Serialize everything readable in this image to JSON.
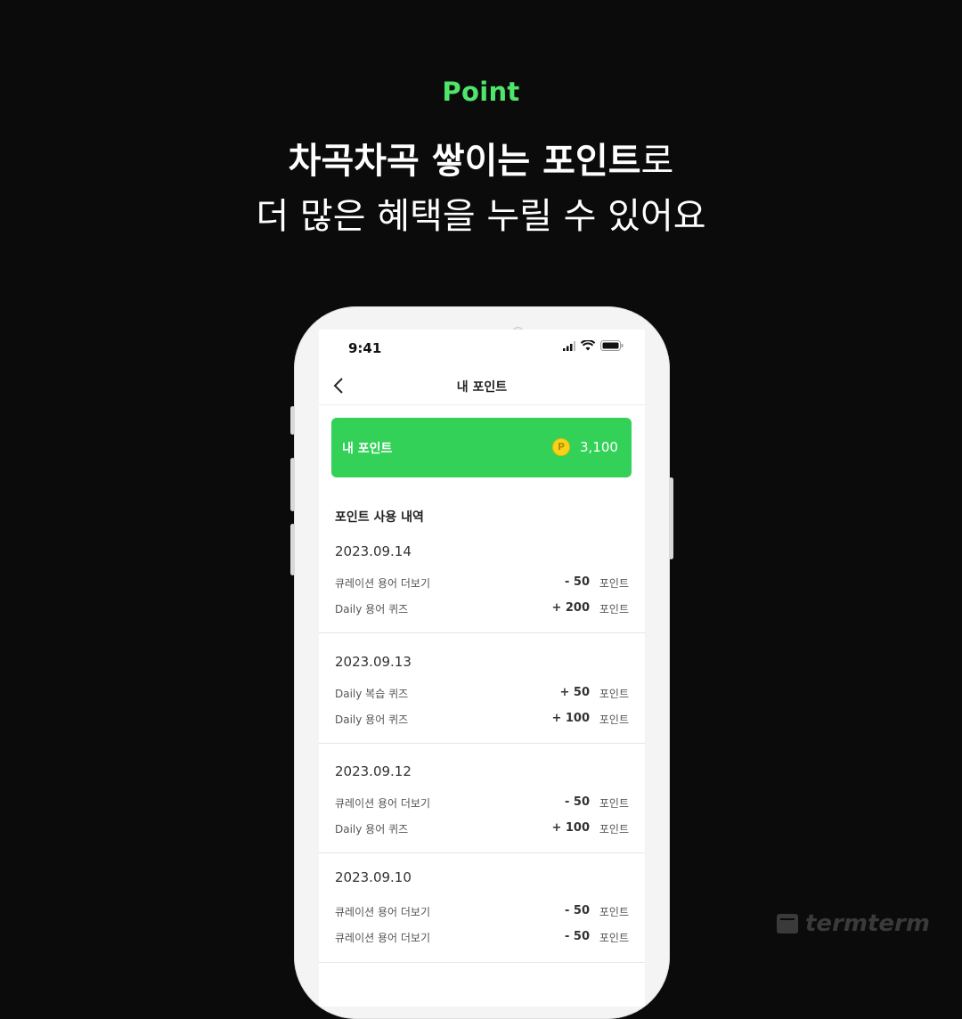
{
  "header": {
    "eyebrow": "Point",
    "headline_line1_bold": "차곡차곡 쌓이는 포인트",
    "headline_line1_regular": "로",
    "headline_line2": "더 많은 혜택을 누릴 수 있어요"
  },
  "status_bar": {
    "time": "9:41"
  },
  "nav": {
    "title": "내 포인트"
  },
  "points_card": {
    "label": "내 포인트",
    "coin_symbol": "P",
    "value": "3,100",
    "color": "#33d158"
  },
  "history": {
    "title": "포인트 사용 내역",
    "days": [
      {
        "date": "2023.09.14",
        "items": [
          {
            "label": "큐레이션 용어 더보기",
            "amount": "- 50",
            "unit": "포인트"
          },
          {
            "label": "Daily 용어 퀴즈",
            "amount": "+ 200",
            "unit": "포인트"
          }
        ]
      },
      {
        "date": "2023.09.13",
        "items": [
          {
            "label": "Daily 복습 퀴즈",
            "amount": "+ 50",
            "unit": "포인트"
          },
          {
            "label": "Daily 용어 퀴즈",
            "amount": "+ 100",
            "unit": "포인트"
          }
        ]
      },
      {
        "date": "2023.09.12",
        "items": [
          {
            "label": "큐레이션 용어 더보기",
            "amount": "- 50",
            "unit": "포인트"
          },
          {
            "label": "Daily 용어 퀴즈",
            "amount": "+ 100",
            "unit": "포인트"
          }
        ]
      },
      {
        "date": "2023.09.10",
        "items": [
          {
            "label": "큐레이션 용어 더보기",
            "amount": "- 50",
            "unit": "포인트"
          },
          {
            "label": "큐레이션 용어 더보기",
            "amount": "- 50",
            "unit": "포인트"
          }
        ]
      }
    ]
  },
  "brand": {
    "name": "termterm"
  },
  "colors": {
    "accent_green": "#4fe46a",
    "background": "#0b0b0b"
  }
}
